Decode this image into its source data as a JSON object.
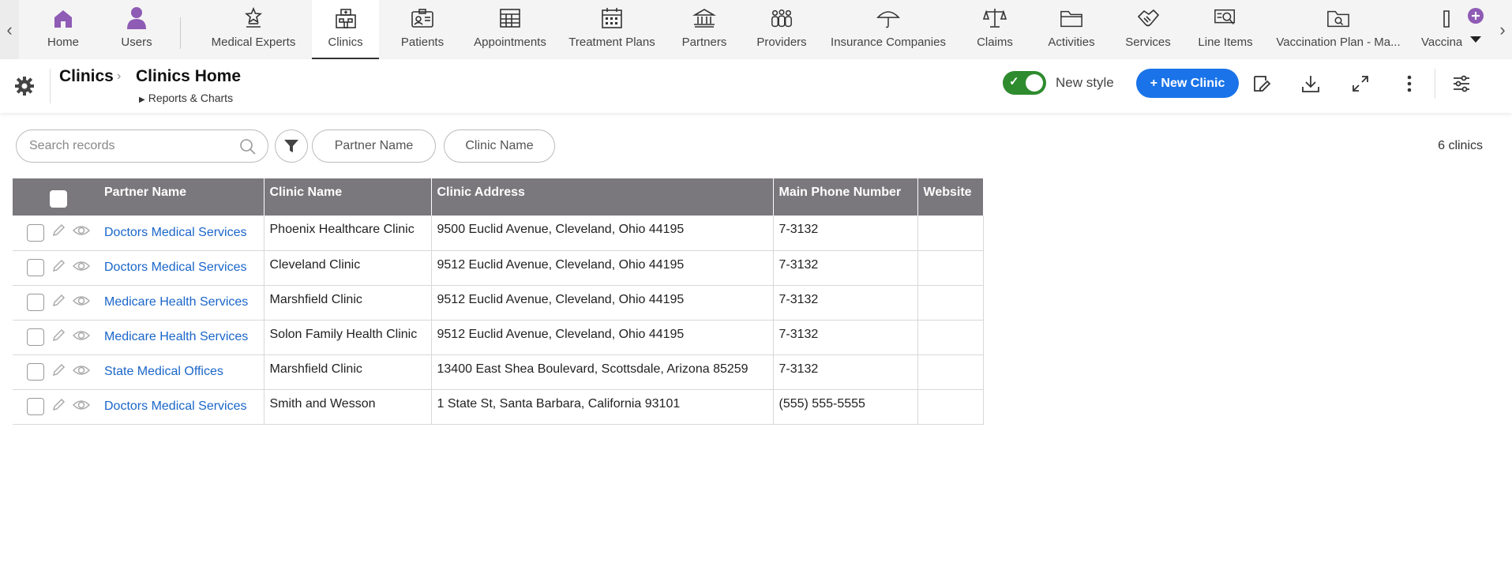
{
  "nav": {
    "items": [
      {
        "label": "Home",
        "icon": "home-icon"
      },
      {
        "label": "Users",
        "icon": "user-icon"
      },
      {
        "label": "Medical Experts",
        "icon": "medical-expert-icon"
      },
      {
        "label": "Clinics",
        "icon": "clinic-icon"
      },
      {
        "label": "Patients",
        "icon": "patient-card-icon"
      },
      {
        "label": "Appointments",
        "icon": "appointments-grid-icon"
      },
      {
        "label": "Treatment Plans",
        "icon": "calendar-icon"
      },
      {
        "label": "Partners",
        "icon": "bank-icon"
      },
      {
        "label": "Providers",
        "icon": "providers-group-icon"
      },
      {
        "label": "Insurance Companies",
        "icon": "umbrella-icon"
      },
      {
        "label": "Claims",
        "icon": "scales-icon"
      },
      {
        "label": "Activities",
        "icon": "folder-icon"
      },
      {
        "label": "Services",
        "icon": "handshake-icon"
      },
      {
        "label": "Line Items",
        "icon": "search-list-icon"
      },
      {
        "label": "Vaccination Plan - Ma...",
        "icon": "folder-search-icon"
      },
      {
        "label": "Vaccina",
        "icon": "folder-icon"
      }
    ],
    "active": "Clinics"
  },
  "header": {
    "breadcrumb_root": "Clinics",
    "breadcrumb_current": "Clinics Home",
    "reports_label": "Reports & Charts",
    "toggle_label": "New style",
    "toggle_on": true,
    "new_button": "+ New Clinic"
  },
  "filters": {
    "search_placeholder": "Search records",
    "pills": [
      "Partner Name",
      "Clinic Name"
    ],
    "count": "6 clinics"
  },
  "table": {
    "columns": [
      "Partner Name",
      "Clinic Name",
      "Clinic Address",
      "Main Phone Number",
      "Website"
    ],
    "rows": [
      {
        "partner": "Doctors Medical Services",
        "clinic": "Phoenix Healthcare Clinic",
        "address": "9500 Euclid Avenue, Cleveland, Ohio 44195",
        "phone": "7-3132",
        "website": ""
      },
      {
        "partner": "Doctors Medical Services",
        "clinic": "Cleveland Clinic",
        "address": "9512 Euclid Avenue, Cleveland, Ohio 44195",
        "phone": "7-3132",
        "website": ""
      },
      {
        "partner": "Medicare Health Services",
        "clinic": "Marshfield Clinic",
        "address": "9512 Euclid Avenue, Cleveland, Ohio 44195",
        "phone": "7-3132",
        "website": ""
      },
      {
        "partner": "Medicare Health Services",
        "clinic": "Solon Family Health Clinic",
        "address": "9512 Euclid Avenue, Cleveland, Ohio 44195",
        "phone": "7-3132",
        "website": ""
      },
      {
        "partner": "State Medical Offices",
        "clinic": "Marshfield Clinic",
        "address": "13400 East Shea Boulevard, Scottsdale, Arizona 85259",
        "phone": "7-3132",
        "website": ""
      },
      {
        "partner": "Doctors Medical Services",
        "clinic": "Smith and Wesson",
        "address": "1 State St, Santa Barbara, California 93101",
        "phone": "(555) 555-5555",
        "website": ""
      }
    ]
  },
  "colors": {
    "accent": "#1a73e8",
    "toggle": "#2e8b2e",
    "header_bg": "#7a787c",
    "link": "#1a66c9",
    "purple": "#8e5bb5"
  }
}
